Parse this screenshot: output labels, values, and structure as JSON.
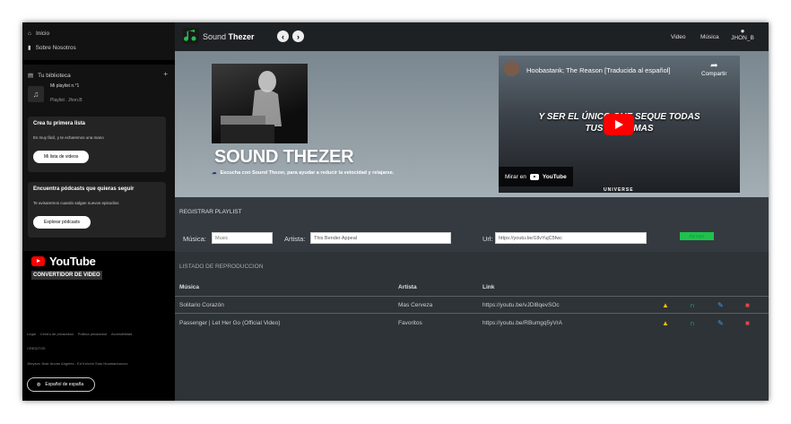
{
  "sidebar": {
    "nav": [
      {
        "label": "Inicio",
        "icon": "home-icon"
      },
      {
        "label": "Sobre Nosotros",
        "icon": "building-icon"
      }
    ],
    "library": {
      "title": "Tu biblioteca",
      "add": "+",
      "playlist": {
        "name": "Mi playlist n.°1",
        "subtitle": "Playlist . Jhon.B"
      }
    },
    "cards": [
      {
        "title": "Crea tu primera lista",
        "text": "Es muy fácil, y te echaremos una mano",
        "button": "Mi lista de videos"
      },
      {
        "title": "Encuentra pódcasts que quieras seguir",
        "text": "Te avisaremos cuando salgan nuevos episodios",
        "button": "Explorar pódcasts"
      }
    ],
    "youtube": {
      "word": "YouTube",
      "subtitle": "CONVERTIDOR DE VIDEO"
    },
    "footer": {
      "links": [
        "Legal",
        "Centro de privacidad",
        "Politica privacidad",
        "Accesibilidad"
      ],
      "credits": "CREDITOS",
      "names": "Jheyson Jhair Anone Angeles - Ed Kelvvin Soto Huamanhorcco",
      "language": "Español de españa"
    }
  },
  "topbar": {
    "brand_prefix": "Sound",
    "brand_suffix": "Thezer",
    "back": "‹",
    "forward": "›",
    "links": [
      "Video",
      "Música"
    ],
    "user": "JHON_B"
  },
  "hero": {
    "title": "SOUND THEZER",
    "subtitle": "Escucha con Sound Thezer, para ayudar a reducir la velocidad y relajarse."
  },
  "video": {
    "title": "Hoobastank; The Reason [Traducida al español]",
    "share": "Compartir",
    "lyrics_line1": "Y SER EL ÚNICO QUE SEQUE TODAS",
    "lyrics_line2": "TUS LÁGRIMAS",
    "watch_on": "Mirar en",
    "yt_word": "YouTube",
    "watermark": "UNIVERSE"
  },
  "form": {
    "section_title": "REGISTRAR PLAYLIST",
    "musica_label": "Música:",
    "musica_placeholder": "Music",
    "artista_label": "Artista:",
    "artista_value": "This Bender Appeal",
    "url_label": "Url:",
    "url_value": "https://youtu.be/18vYujC5fwc",
    "submit": "Agregar"
  },
  "list": {
    "title": "LISTADO DE REPRODUCCION",
    "headers": [
      "Música",
      "Artista",
      "Link"
    ],
    "rows": [
      {
        "musica": "Solitario Corazón",
        "artista": "Mas Cerveza",
        "link": "https://youtu.be/vJDl8qevSOc"
      },
      {
        "musica": "Passenger | Let Her Go (Official Video)",
        "artista": "Favoritos",
        "link": "https://youtu.be/RBumgq5yVrA"
      }
    ]
  },
  "colors": {
    "accent": "#1fc24c",
    "download": "#f0c000",
    "listen": "#20c997",
    "edit": "#3ea0f0",
    "delete": "#e04848"
  }
}
